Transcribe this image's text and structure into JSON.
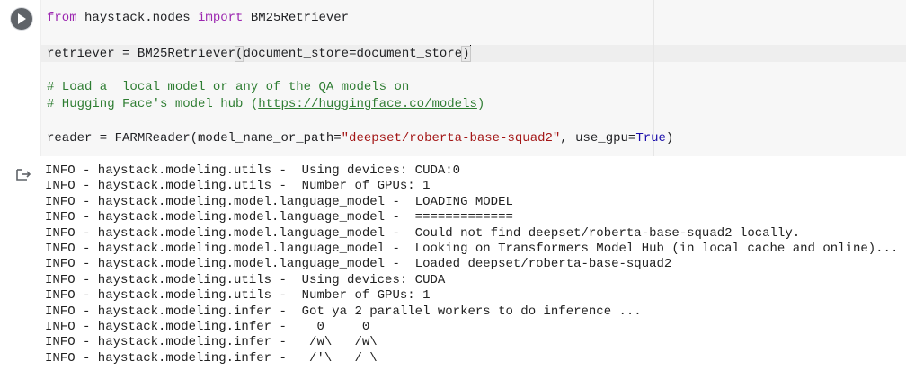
{
  "code": {
    "line1": {
      "kw_from": "from",
      "module": " haystack.nodes ",
      "kw_import": "import",
      "name": " BM25Retriever"
    },
    "line2": {
      "before": "retriever = BM25Retriever",
      "open": "(",
      "args": "document_store=document_store",
      "close": ")"
    },
    "line3": {
      "text": "# Load a  local model or any of the QA models on"
    },
    "line4": {
      "prefix": "# Hugging Face's model hub (",
      "url": "https://huggingface.co/models",
      "suffix": ")"
    },
    "line5": {
      "before": "reader = FARMReader(model_name_or_path=",
      "str": "\"deepset/roberta-base-squad2\"",
      "mid": ", use_gpu=",
      "const": "True",
      "after": ")"
    }
  },
  "output": {
    "lines": [
      "INFO - haystack.modeling.utils -  Using devices: CUDA:0",
      "INFO - haystack.modeling.utils -  Number of GPUs: 1",
      "INFO - haystack.modeling.model.language_model -  LOADING MODEL",
      "INFO - haystack.modeling.model.language_model -  =============",
      "INFO - haystack.modeling.model.language_model -  Could not find deepset/roberta-base-squad2 locally.",
      "INFO - haystack.modeling.model.language_model -  Looking on Transformers Model Hub (in local cache and online)...",
      "INFO - haystack.modeling.model.language_model -  Loaded deepset/roberta-base-squad2",
      "INFO - haystack.modeling.utils -  Using devices: CUDA",
      "INFO - haystack.modeling.utils -  Number of GPUs: 1",
      "INFO - haystack.modeling.infer -  Got ya 2 parallel workers to do inference ...",
      "INFO - haystack.modeling.infer -    0     0",
      "INFO - haystack.modeling.infer -   /w\\   /w\\",
      "INFO - haystack.modeling.infer -   /'\\   / \\"
    ]
  },
  "icons": {
    "run": "play-icon",
    "output": "output-arrow-icon"
  },
  "colors": {
    "keyword": "#9c27b0",
    "comment": "#2e7d32",
    "string": "#a31515",
    "constant": "#1a0dab",
    "editor_bg": "#f7f7f7",
    "run_button": "#5f6368"
  }
}
